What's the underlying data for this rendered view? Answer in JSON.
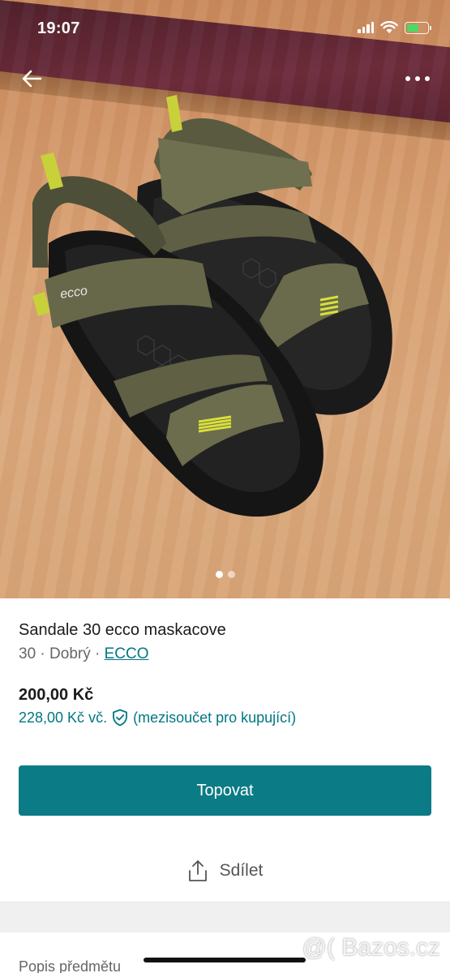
{
  "status_bar": {
    "time": "19:07"
  },
  "listing": {
    "title": "Sandale 30 ecco maskacove",
    "size": "30",
    "separator": " · ",
    "condition": "Dobrý",
    "brand": "ECCO",
    "price": "200,00 Kč",
    "buyer_price": "228,00 Kč vč.",
    "buyer_note": "(mezisoučet pro kupující)"
  },
  "photo": {
    "shoe_logo_text": "ecco",
    "image_count": 2,
    "active_index": 0
  },
  "actions": {
    "bump_label": "Topovat",
    "share_label": "Sdílet"
  },
  "sections": {
    "description_heading": "Popis předmětu"
  },
  "watermark": {
    "text": "@( Bazos.cz"
  },
  "colors": {
    "accent": "#007782",
    "button": "#0b7b85",
    "battery": "#4cd964"
  },
  "icons": [
    "back-arrow-icon",
    "more-icon",
    "shield-check-icon",
    "share-icon",
    "signal-icon",
    "wifi-icon",
    "battery-icon"
  ]
}
